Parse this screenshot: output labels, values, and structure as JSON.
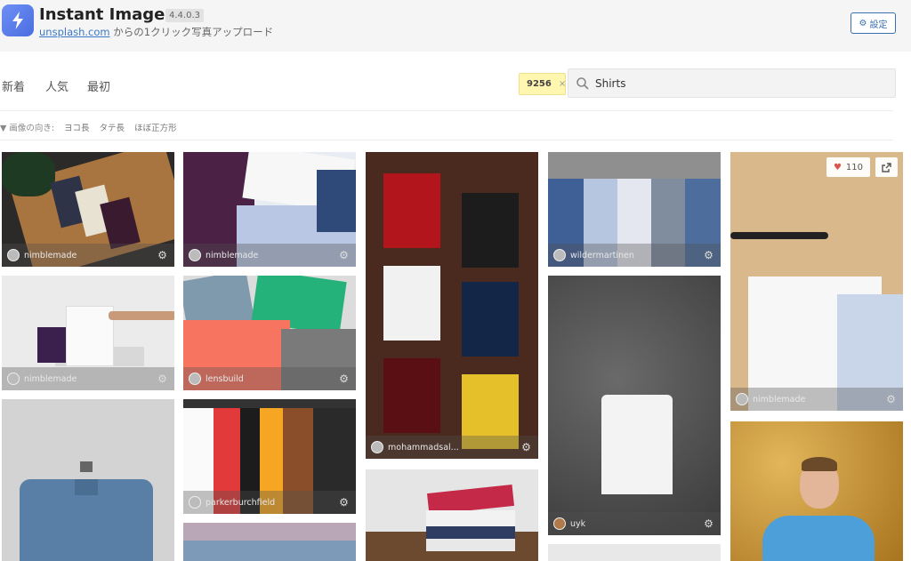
{
  "header": {
    "title": "Instant Images",
    "version": "4.4.0.3",
    "tagline_link": "unsplash.com",
    "tagline_rest": " からの1クリック写真アップロード",
    "settings_label": "設定"
  },
  "toolbar": {
    "tabs": [
      "新着",
      "人気",
      "最初"
    ],
    "result_count": "9256",
    "search_value": "Shirts",
    "filter_label": "画像の向き:",
    "orientations": [
      "ヨコ長",
      "タテ長",
      "ほぼ正方形"
    ]
  },
  "photos": [
    {
      "user": "nimblemade"
    },
    {
      "user": "nimblemade"
    },
    {
      "user": "mohammadsal..."
    },
    {
      "user": "wildermartinen"
    },
    {
      "user": "nimblemade",
      "likes": "110"
    },
    {
      "user": "nimblemade"
    },
    {
      "user": "lensbuild"
    },
    {
      "user": "parkerburchfield"
    },
    {
      "user": "uyk"
    }
  ],
  "colors": {
    "accent": "#3a6fb0",
    "logo": "#5b7fe8",
    "badge": "#fff7b0"
  }
}
